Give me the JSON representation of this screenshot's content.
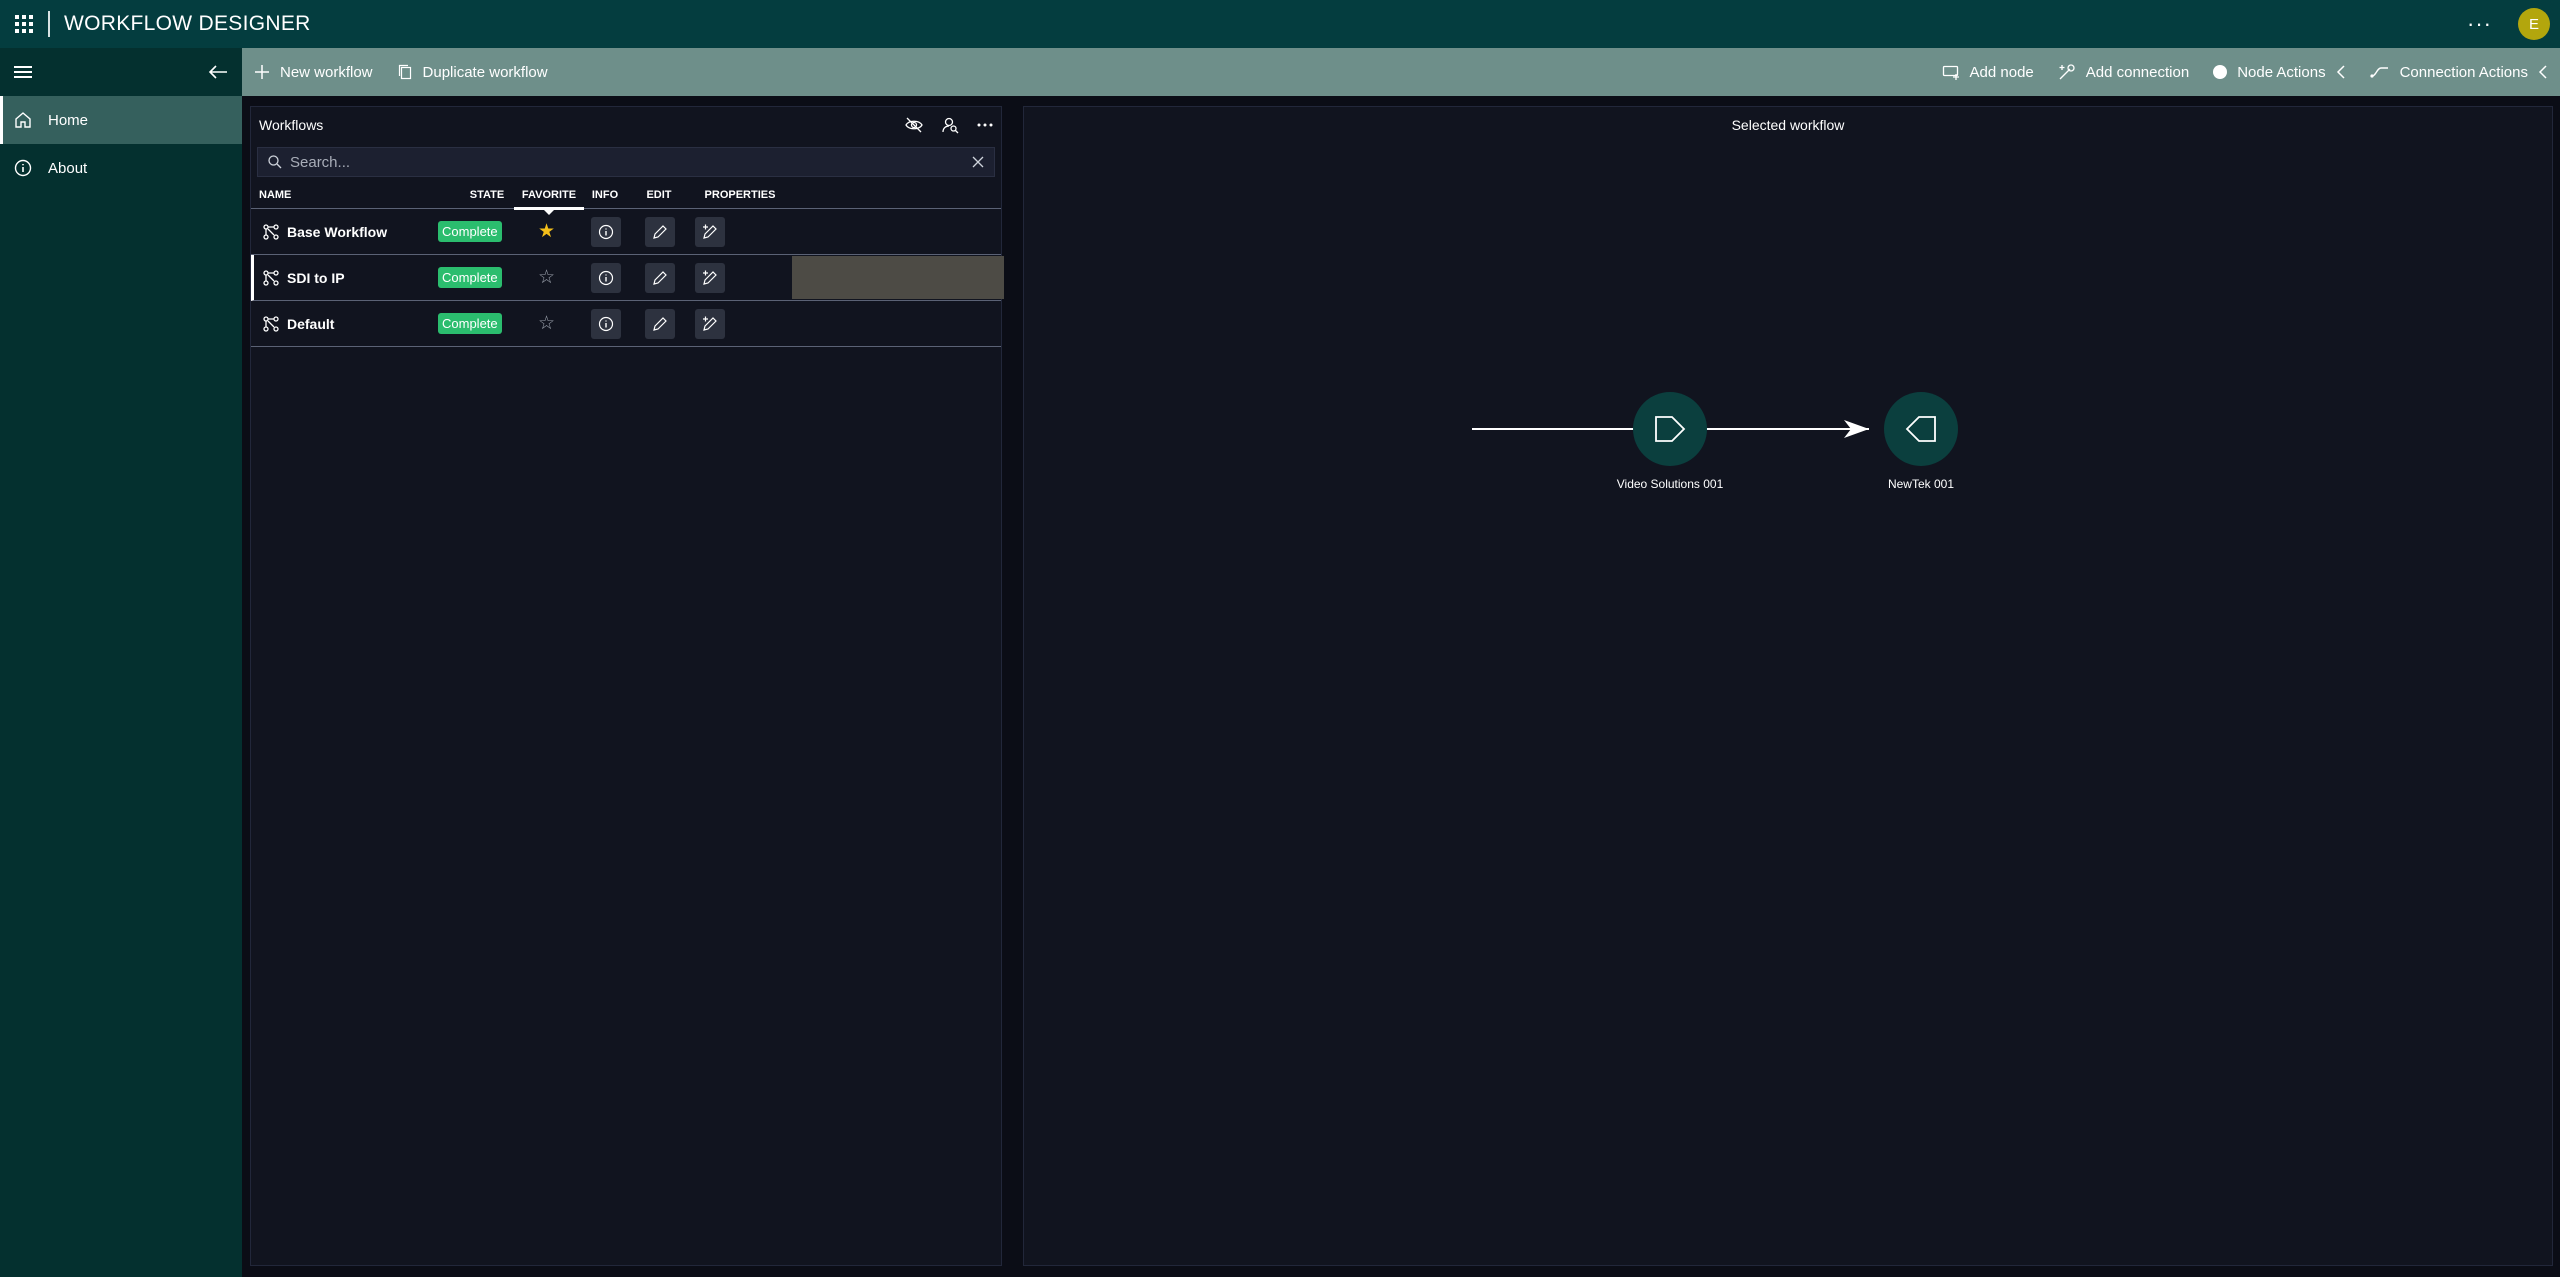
{
  "app": {
    "title": "WORKFLOW DESIGNER",
    "user_initial": "E",
    "more_label": "···"
  },
  "sidebar": {
    "items": [
      {
        "label": "Home",
        "icon": "home-icon",
        "active": true
      },
      {
        "label": "About",
        "icon": "info-icon",
        "active": false
      }
    ]
  },
  "commandbar": {
    "new_workflow": "New workflow",
    "duplicate_workflow": "Duplicate workflow",
    "add_node": "Add node",
    "add_connection": "Add connection",
    "node_actions": "Node Actions",
    "connection_actions": "Connection Actions"
  },
  "workflows_panel": {
    "title": "Workflows",
    "search_placeholder": "Search...",
    "columns": {
      "name": "NAME",
      "state": "STATE",
      "favorite": "FAVORITE",
      "info": "INFO",
      "edit": "EDIT",
      "properties": "PROPERTIES"
    },
    "sorted_column": "favorite",
    "rows": [
      {
        "name": "Base Workflow",
        "state": "Complete",
        "favorite": true,
        "selected": false
      },
      {
        "name": "SDI to IP",
        "state": "Complete",
        "favorite": false,
        "selected": true
      },
      {
        "name": "Default",
        "state": "Complete",
        "favorite": false,
        "selected": false
      }
    ]
  },
  "selected_workflow": {
    "title": "Selected workflow",
    "nodes": [
      {
        "label": "Video Solutions 001",
        "icon": "source-node-icon"
      },
      {
        "label": "NewTek 001",
        "icon": "destination-node-icon"
      }
    ],
    "connections": [
      {
        "from": "Video Solutions 001",
        "to": "NewTek 001"
      }
    ]
  },
  "colors": {
    "header": "#043d3f",
    "sidebar": "#04302f",
    "commandbar": "#6e8f8a",
    "background": "#0b0d16",
    "panel": "#11141f",
    "badge_complete": "#2bbd6e",
    "favorite_star": "#f4bf1a",
    "node": "#0b3f3e",
    "avatar": "#b3a60d"
  }
}
